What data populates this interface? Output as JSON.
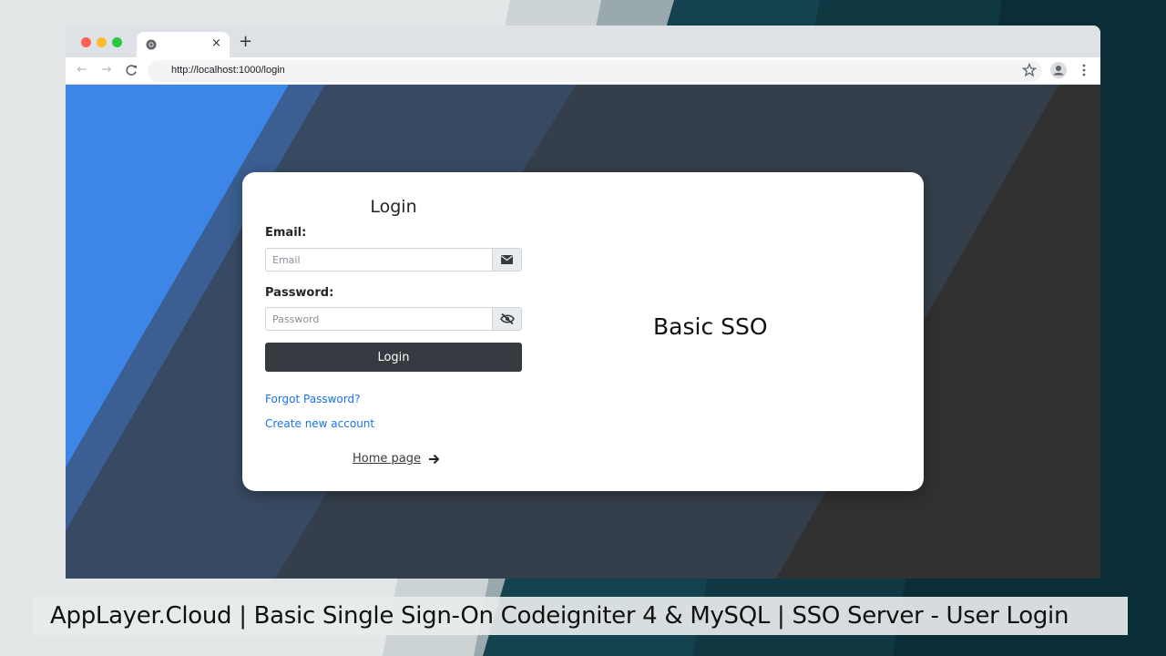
{
  "browser": {
    "url": "http://localhost:1000/login",
    "tab_close": "×",
    "new_tab": "+",
    "nav_back": "←",
    "nav_forward": "→",
    "nav_reload": "C"
  },
  "login": {
    "title": "Login",
    "email_label": "Email:",
    "email_placeholder": "Email",
    "password_label": "Password:",
    "password_placeholder": "Password",
    "submit_label": "Login",
    "forgot_link": "Forgot Password?",
    "create_link": "Create new account",
    "home_link": "Home page"
  },
  "brand": {
    "title": "Basic SSO"
  },
  "caption": {
    "text": "AppLayer.Cloud | Basic Single Sign-On Codeigniter 4 & MySQL | SSO Server - User Login"
  },
  "colors": {
    "accent_blue": "#3d86e8",
    "dark_button": "#343a40",
    "link": "#1a73e8"
  },
  "icons": {
    "email_addon": "envelope-icon",
    "password_addon": "eye-slash-icon",
    "home": "arrow-right-icon",
    "bookmark": "star-icon",
    "profile": "avatar-icon",
    "menu": "kebab-menu-icon"
  }
}
